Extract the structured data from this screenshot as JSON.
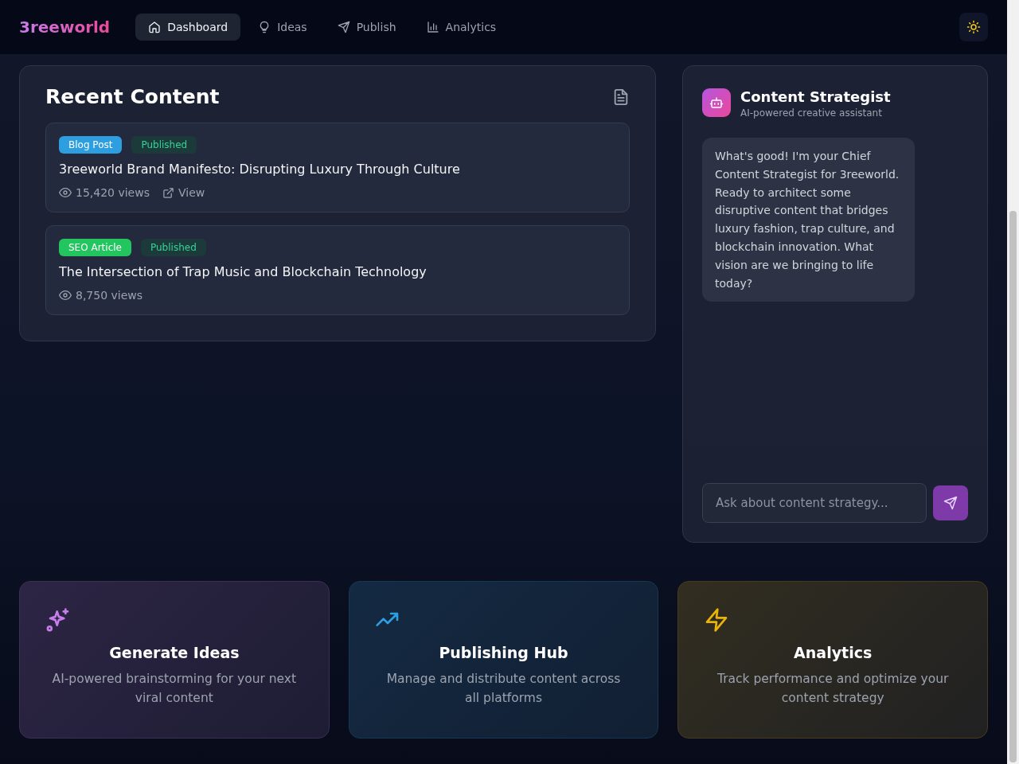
{
  "header": {
    "logo": "3reeworld",
    "tabs": [
      {
        "label": "Dashboard",
        "kind": "home",
        "selected": true
      },
      {
        "label": "Ideas",
        "kind": "bulb",
        "selected": false
      },
      {
        "label": "Publish",
        "kind": "send",
        "selected": false
      },
      {
        "label": "Analytics",
        "kind": "chart",
        "selected": false
      }
    ]
  },
  "recent": {
    "title": "Recent Content",
    "items": [
      {
        "type": "Blog Post",
        "color": "#2d9ee0",
        "status": "Published",
        "title": "3reeworld Brand Manifesto: Disrupting Luxury Through Culture",
        "views": "15,420 views",
        "link": "View"
      },
      {
        "type": "SEO Article",
        "color": "#22c55e",
        "status": "Published",
        "title": "The Intersection of Trap Music and Blockchain Technology",
        "views": "8,750 views"
      }
    ]
  },
  "assistant": {
    "name": "Content Strategist",
    "subtitle": "AI-powered creative assistant",
    "messages": [
      {
        "text": "What's good! I'm your Chief Content Strategist for 3reeworld. Ready to architect some disruptive content that bridges luxury fashion, trap culture, and blockchain innovation. What vision are we bringing to life today?"
      }
    ],
    "input": {
      "placeholder": "Ask about content strategy..."
    }
  },
  "features": [
    {
      "kind": "sparkles",
      "color": "#c77dea",
      "title": "Generate Ideas",
      "text": "AI-powered brainstorming for your next viral content"
    },
    {
      "kind": "trend",
      "color": "#2d9ee0",
      "title": "Publishing Hub",
      "text": "Manage and distribute content across all platforms"
    },
    {
      "kind": "bolt",
      "color": "#eab308",
      "title": "Analytics",
      "text": "Track performance and optimize your content strategy"
    }
  ]
}
